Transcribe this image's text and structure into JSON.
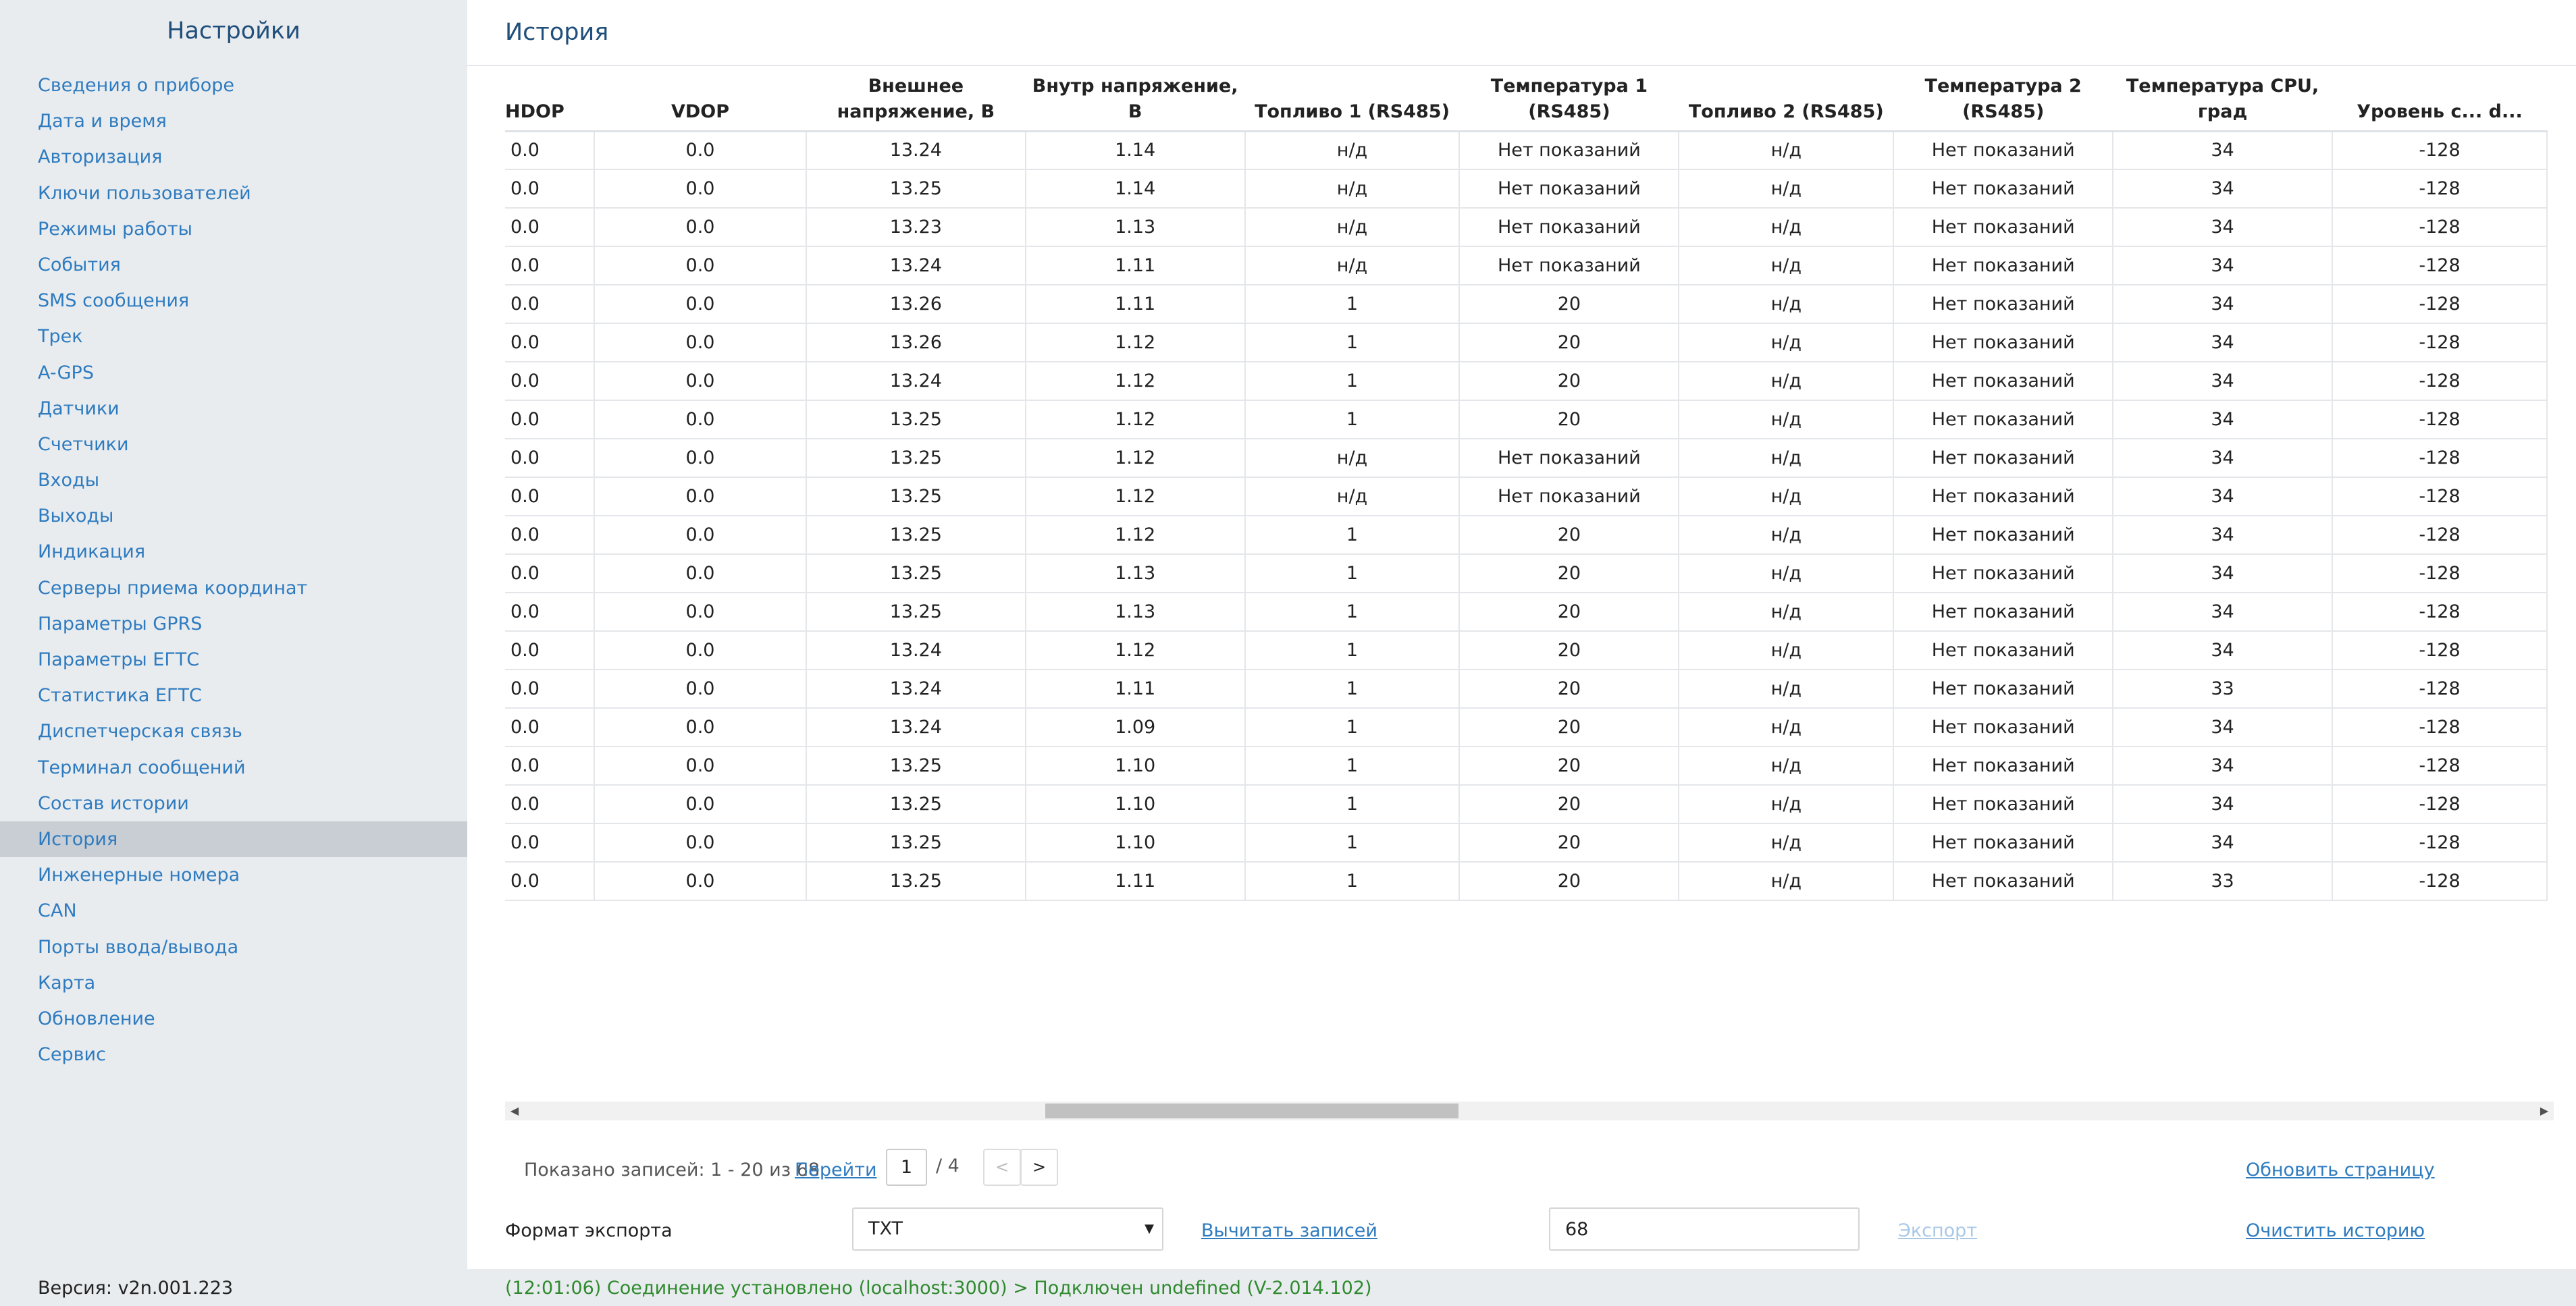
{
  "sidebar": {
    "title": "Настройки",
    "items": [
      "Сведения о приборе",
      "Дата и время",
      "Авторизация",
      "Ключи пользователей",
      "Режимы работы",
      "События",
      "SMS сообщения",
      "Трек",
      "A-GPS",
      "Датчики",
      "Счетчики",
      "Входы",
      "Выходы",
      "Индикация",
      "Серверы приема координат",
      "Параметры GPRS",
      "Параметры ЕГТС",
      "Статистика ЕГТС",
      "Диспетчерская связь",
      "Терминал сообщений",
      "Состав истории",
      "История",
      "Инженерные номера",
      "CAN",
      "Порты ввода/вывода",
      "Карта",
      "Обновление",
      "Сервис"
    ],
    "active_index": 21,
    "version": "Версия: v2n.001.223"
  },
  "page": {
    "title": "История"
  },
  "table": {
    "headers": [
      "HDOP",
      "VDOP",
      "Внешнее напряжение, В",
      "Внутр напряжение, В",
      "Топливо 1 (RS485)",
      "Температура 1 (RS485)",
      "Топливо 2 (RS485)",
      "Температура 2 (RS485)",
      "Температура CPU, град",
      "Уровень с... d..."
    ],
    "rows": [
      [
        "0.0",
        "0.0",
        "13.24",
        "1.14",
        "н/д",
        "Нет показаний",
        "н/д",
        "Нет показаний",
        "34",
        "-128"
      ],
      [
        "0.0",
        "0.0",
        "13.25",
        "1.14",
        "н/д",
        "Нет показаний",
        "н/д",
        "Нет показаний",
        "34",
        "-128"
      ],
      [
        "0.0",
        "0.0",
        "13.23",
        "1.13",
        "н/д",
        "Нет показаний",
        "н/д",
        "Нет показаний",
        "34",
        "-128"
      ],
      [
        "0.0",
        "0.0",
        "13.24",
        "1.11",
        "н/д",
        "Нет показаний",
        "н/д",
        "Нет показаний",
        "34",
        "-128"
      ],
      [
        "0.0",
        "0.0",
        "13.26",
        "1.11",
        "1",
        "20",
        "н/д",
        "Нет показаний",
        "34",
        "-128"
      ],
      [
        "0.0",
        "0.0",
        "13.26",
        "1.12",
        "1",
        "20",
        "н/д",
        "Нет показаний",
        "34",
        "-128"
      ],
      [
        "0.0",
        "0.0",
        "13.24",
        "1.12",
        "1",
        "20",
        "н/д",
        "Нет показаний",
        "34",
        "-128"
      ],
      [
        "0.0",
        "0.0",
        "13.25",
        "1.12",
        "1",
        "20",
        "н/д",
        "Нет показаний",
        "34",
        "-128"
      ],
      [
        "0.0",
        "0.0",
        "13.25",
        "1.12",
        "н/д",
        "Нет показаний",
        "н/д",
        "Нет показаний",
        "34",
        "-128"
      ],
      [
        "0.0",
        "0.0",
        "13.25",
        "1.12",
        "н/д",
        "Нет показаний",
        "н/д",
        "Нет показаний",
        "34",
        "-128"
      ],
      [
        "0.0",
        "0.0",
        "13.25",
        "1.12",
        "1",
        "20",
        "н/д",
        "Нет показаний",
        "34",
        "-128"
      ],
      [
        "0.0",
        "0.0",
        "13.25",
        "1.13",
        "1",
        "20",
        "н/д",
        "Нет показаний",
        "34",
        "-128"
      ],
      [
        "0.0",
        "0.0",
        "13.25",
        "1.13",
        "1",
        "20",
        "н/д",
        "Нет показаний",
        "34",
        "-128"
      ],
      [
        "0.0",
        "0.0",
        "13.24",
        "1.12",
        "1",
        "20",
        "н/д",
        "Нет показаний",
        "34",
        "-128"
      ],
      [
        "0.0",
        "0.0",
        "13.24",
        "1.11",
        "1",
        "20",
        "н/д",
        "Нет показаний",
        "33",
        "-128"
      ],
      [
        "0.0",
        "0.0",
        "13.24",
        "1.09",
        "1",
        "20",
        "н/д",
        "Нет показаний",
        "34",
        "-128"
      ],
      [
        "0.0",
        "0.0",
        "13.25",
        "1.10",
        "1",
        "20",
        "н/д",
        "Нет показаний",
        "34",
        "-128"
      ],
      [
        "0.0",
        "0.0",
        "13.25",
        "1.10",
        "1",
        "20",
        "н/д",
        "Нет показаний",
        "34",
        "-128"
      ],
      [
        "0.0",
        "0.0",
        "13.25",
        "1.10",
        "1",
        "20",
        "н/д",
        "Нет показаний",
        "34",
        "-128"
      ],
      [
        "0.0",
        "0.0",
        "13.25",
        "1.11",
        "1",
        "20",
        "н/д",
        "Нет показаний",
        "33",
        "-128"
      ]
    ]
  },
  "pager": {
    "shown_text": "Показано записей: 1 - 20 из 68",
    "goto_label": "Перейти",
    "page_value": "1",
    "total_text": "/ 4",
    "prev_label": "<",
    "next_label": ">",
    "refresh_label": "Обновить страницу"
  },
  "export": {
    "label": "Формат экспорта",
    "format_value": "TXT",
    "read_label": "Вычитать записей",
    "count_value": "68",
    "export_label": "Экспорт",
    "clear_label": "Очистить историю"
  },
  "status": {
    "text": "(12:01:06) Соединение установлено (localhost:3000) > Подключен undefined (V-2.014.102)",
    "color": "#2f8a2f"
  },
  "colors": {
    "accent": "#2e7bbf",
    "title": "#1f4f7a",
    "sidebar_bg": "#e9ecef",
    "active_bg": "#c9ced5"
  }
}
